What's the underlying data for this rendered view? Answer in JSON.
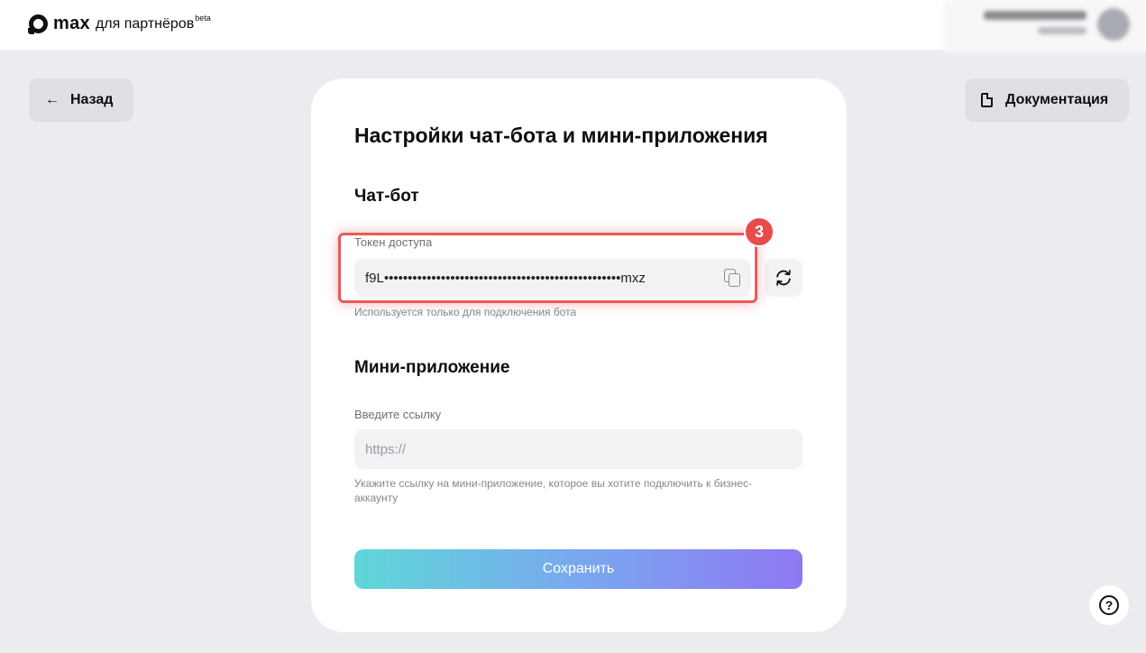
{
  "header": {
    "logo_max": "max",
    "logo_partners": "для партнёров",
    "logo_beta": "beta"
  },
  "nav": {
    "back_label": "Назад",
    "docs_label": "Документация"
  },
  "card": {
    "title": "Настройки чат-бота и мини-приложения",
    "chatbot": {
      "heading": "Чат-бот",
      "token_label": "Токен доступа",
      "token_value": "f9L••••••••••••••••••••••••••••••••••••••••••••••••••mxz",
      "token_hint": "Используется только для подключения бота",
      "step_badge": "3"
    },
    "miniapp": {
      "heading": "Мини-приложение",
      "link_label": "Введите ссылку",
      "link_placeholder": "https://",
      "link_hint": "Укажите ссылку на мини-приложение, которое вы хотите подключить к бизнес-аккаунту"
    },
    "save_label": "Сохранить"
  },
  "help": {
    "icon": "question-icon"
  },
  "colors": {
    "background": "#ebecef",
    "highlight": "#e95a5a",
    "save_gradient_start": "#5fd7d7",
    "save_gradient_end": "#8f78f3"
  }
}
